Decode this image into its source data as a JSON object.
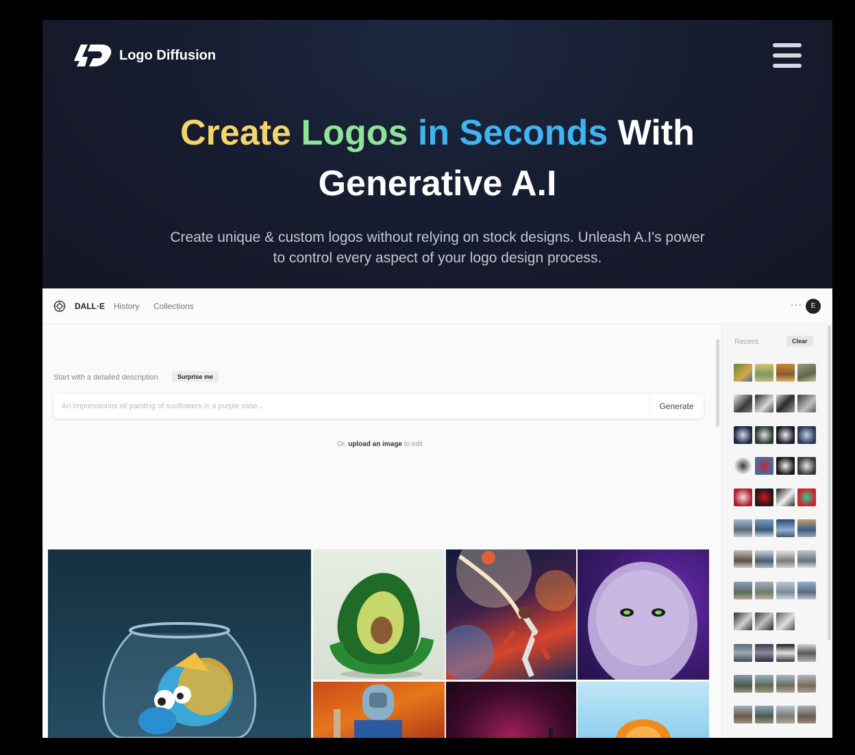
{
  "brand": {
    "name": "Logo Diffusion"
  },
  "hero": {
    "headline_word1": "Create",
    "headline_word2": "Logos",
    "headline_word3": "in Seconds",
    "headline_word4": "With",
    "headline_line2": "Generative A.I",
    "subtitle_line1": "Create unique & custom logos without relying on stock designs. Unleash A.I's power",
    "subtitle_line2": "to control every aspect of your logo design process."
  },
  "colors": {
    "headline_yellow": "#f3d56b",
    "headline_green": "#8fe39a",
    "headline_blue": "#3fb4f0"
  },
  "app": {
    "name": "DALL·E",
    "nav": [
      "History",
      "Collections"
    ],
    "more": "···",
    "avatar_initial": "E",
    "describe_label": "Start with a detailed description",
    "surprise_label": "Surprise me",
    "prompt_placeholder": "An Impressionist oil painting of sunflowers in a purple vase...",
    "prompt_value": "",
    "generate_label": "Generate",
    "upload_prefix": "Or,",
    "upload_link": "upload an image",
    "upload_suffix": "to edit",
    "recent_label": "Recent",
    "clear_label": "Clear"
  },
  "icons": [
    "logo-diffusion-mark-icon",
    "hamburger-menu-icon",
    "openai-icon"
  ]
}
